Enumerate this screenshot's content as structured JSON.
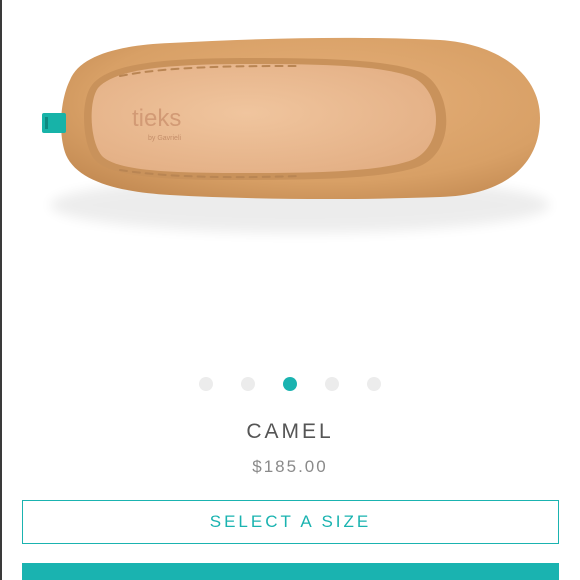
{
  "product_image": {
    "alt": "",
    "brand_mark": "tieks",
    "brand_sub": "by Gavrieli",
    "heel_tab_color": "#17b3a8",
    "leather_color": "#d9a369",
    "insole_color": "#eab88f"
  },
  "carousel": {
    "count": 5,
    "active_index": 2,
    "active_color": "#1ab3b0"
  },
  "product": {
    "name": "CAMEL",
    "price": "$185.00"
  },
  "actions": {
    "select_size_label": "SELECT A SIZE",
    "accent_color": "#1ab3b0"
  }
}
